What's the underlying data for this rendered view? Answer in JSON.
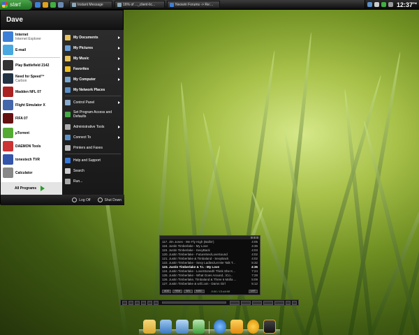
{
  "colors": {
    "accent_green": "#2a9d2a",
    "taskbar": "#111111",
    "menu_dark": "#1b1b1b"
  },
  "taskbar": {
    "start_label": "start",
    "quicklaunch": [
      "ie-icon",
      "runner-icon",
      "messenger-icon",
      "desktop-icon"
    ],
    "tasks": [
      {
        "label": "Instant Message",
        "icon": "chat-icon"
      },
      {
        "label": "16% of ..._client-lic...",
        "icon": "download-icon"
      },
      {
        "label": "Neowin Forums -> Re:...",
        "icon": "ie-icon"
      }
    ],
    "tray_icons": [
      "network-icon",
      "volume-icon",
      "messenger-icon",
      "gear-icon"
    ],
    "clock": "12:37",
    "clock_suffix": "PM"
  },
  "start_menu": {
    "user": "Dave",
    "pinned": [
      {
        "main": "Internet",
        "sub": "Internet Explorer",
        "icon": "ie-icon",
        "color": "#3d7fd6"
      },
      {
        "main": "E-mail",
        "sub": "",
        "icon": "mail-icon",
        "color": "#4aa8e0"
      }
    ],
    "recent": [
      {
        "main": "Play Battlefield 2142",
        "icon": "bf2142-icon",
        "color": "#333333"
      },
      {
        "main": "Need for Speed™",
        "sub": "Carbon",
        "icon": "nfs-icon",
        "color": "#223344"
      },
      {
        "main": "Madden NFL 07",
        "icon": "madden-icon",
        "color": "#aa2222"
      },
      {
        "main": "Flight Simulator X",
        "icon": "flightsim-icon",
        "color": "#4466aa"
      },
      {
        "main": "FIFA 07",
        "icon": "fifa-icon",
        "color": "#661111"
      },
      {
        "main": "µTorrent",
        "icon": "utorrent-icon",
        "color": "#55aa33"
      },
      {
        "main": "DAEMON Tools",
        "icon": "daemon-icon",
        "color": "#cc3333"
      },
      {
        "main": "tonestech TVR",
        "icon": "tvr-icon",
        "color": "#3355aa"
      },
      {
        "main": "Calculator",
        "icon": "calculator-icon",
        "color": "#888888"
      }
    ],
    "all_programs": "All Programs",
    "right": [
      {
        "label": "My Documents",
        "icon": "folder-icon",
        "color": "#e8c25a",
        "arrow": true,
        "bold": true
      },
      {
        "label": "My Pictures",
        "icon": "pictures-icon",
        "color": "#6aa0d8",
        "arrow": true,
        "bold": true
      },
      {
        "label": "My Music",
        "icon": "music-icon",
        "color": "#e8c25a",
        "arrow": true,
        "bold": true
      },
      {
        "label": "Favorites",
        "icon": "star-icon",
        "color": "#f0c020",
        "arrow": true,
        "bold": true
      },
      {
        "label": "My Computer",
        "icon": "computer-icon",
        "color": "#7aa8d0",
        "arrow": true,
        "bold": true
      },
      {
        "label": "My Network Places",
        "icon": "network-icon",
        "color": "#5a90c8",
        "arrow": false,
        "bold": true
      }
    ],
    "right2": [
      {
        "label": "Control Panel",
        "icon": "control-panel-icon",
        "color": "#88aacc",
        "arrow": true
      },
      {
        "label": "Set Program Access and Defaults",
        "icon": "defaults-icon",
        "color": "#44aa44",
        "arrow": false
      },
      {
        "label": "Administrative Tools",
        "icon": "admin-tools-icon",
        "color": "#aaaaaa",
        "arrow": true
      },
      {
        "label": "Connect To",
        "icon": "connect-icon",
        "color": "#5a90c8",
        "arrow": true
      },
      {
        "label": "Printers and Faxes",
        "icon": "printer-icon",
        "color": "#bbbbbb",
        "arrow": false
      }
    ],
    "right3": [
      {
        "label": "Help and Support",
        "icon": "help-icon",
        "color": "#3a7ad8",
        "arrow": false
      },
      {
        "label": "Search",
        "icon": "search-icon",
        "color": "#cccccc",
        "arrow": false
      },
      {
        "label": "Run...",
        "icon": "run-icon",
        "color": "#aaaaaa",
        "arrow": false
      }
    ],
    "log_off": "Log Off",
    "shut_down": "Shut Down"
  },
  "player": {
    "playlist": [
      {
        "title": "117. Jim Jones - We Fly High (Ballin')",
        "dur": "4:05"
      },
      {
        "title": "118. Justin Timberlake - My Love",
        "dur": "4:36"
      },
      {
        "title": "119. Justin Timberlake - SexyBack",
        "dur": "4:03"
      },
      {
        "title": "120. Justin Timberlake - FutureSex/LoveSound",
        "dur": "4:02"
      },
      {
        "title": "121. Justin Timberlake & Timbaland - SexyBack",
        "dur": "4:02"
      },
      {
        "title": "122. Justin Timberlake - Sexy Ladies/Let Me Talk T...",
        "dur": "5:32"
      },
      {
        "title": "123. Justin Timberlake & T.I. - My Love",
        "dur": "4:36"
      },
      {
        "title": "124. Justin Timberlake - LoveStoned/I Think She K...",
        "dur": "7:24"
      },
      {
        "title": "125. Justin Timberlake - What Goes Around...\\Co...",
        "dur": "7:28"
      },
      {
        "title": "126. Justin Timberlake, Timbaland & Three 6 Mafia ...",
        "dur": "5:09"
      },
      {
        "title": "127. Justin Timberlake & will.i.am - Damn Girl",
        "dur": "5:12"
      }
    ],
    "current_index": 6,
    "buttons": [
      "ADD",
      "REM",
      "SEL",
      "MISC"
    ],
    "time_readout": "0:00 / 13:44:08",
    "buttons_right": [
      "LIST"
    ],
    "seek_fraction": 0.0
  },
  "dock": [
    "folder-icon",
    "network-icon",
    "computer-icon",
    "recycle-bin-icon",
    "ie-icon",
    "runner-icon",
    "messenger-icon",
    "media-icon"
  ]
}
